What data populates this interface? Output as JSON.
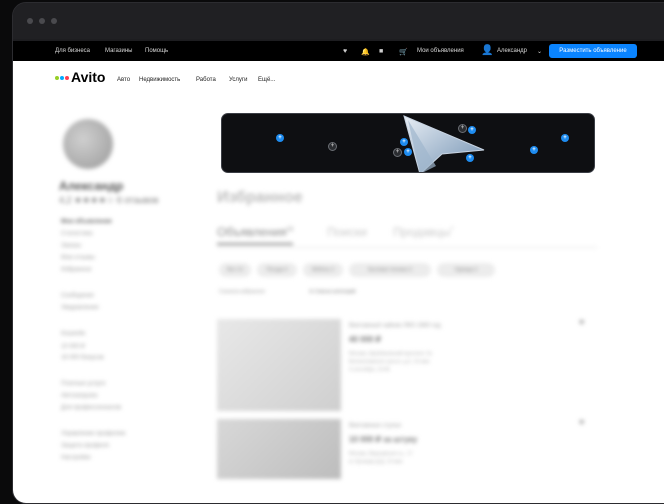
{
  "topbar": {
    "business": "Для бизнеса",
    "shops": "Магазины",
    "help": "Помощь",
    "my_ads": "Мои объявления",
    "user": "Александр",
    "post_button": "Разместить объявление"
  },
  "header": {
    "logo": "Avito",
    "nav": [
      "Авто",
      "Недвижимость",
      "Работа",
      "Услуги",
      "Ещё..."
    ]
  },
  "profile": {
    "name": "Александр",
    "rating": "4,2 ★★★★☆ 6 отзывов",
    "menu": [
      "Мои объявления",
      "Статистика",
      "Заказы",
      "Мои отзывы",
      "Избранное",
      "Сообщения",
      "Уведомления",
      "Кошелёк",
      "10 000 ₽",
      "16 000 бонусов",
      "Платные услуги",
      "Автозагрузка",
      "Для профессионалов",
      "Управление профилем",
      "Защита профиля",
      "Настройки"
    ]
  },
  "main": {
    "title": "Избранное",
    "tabs": [
      {
        "label": "Объявления",
        "count": "13"
      },
      {
        "label": "Поиски",
        "count": ""
      },
      {
        "label": "Продавцы",
        "count": "7"
      }
    ],
    "chips": [
      "Все 13",
      "Посуда 4",
      "Мебель 3",
      "Бытовая техника 3",
      "Одежда 3"
    ],
    "sort_left": "Сначала избранное",
    "sort_right": "⇅ Список категорий",
    "cards": [
      {
        "title": "Винтажный чайник ЛФЗ 1960 год",
        "price": "40 000 ₽",
        "sub1": "Москва, Щербаковский проспект, 5к",
        "sub2": "Волоколамское шоссе, д.2, 15 мин",
        "sub3": "4 сентября, 19:45"
      },
      {
        "title": "Винтажные стулья",
        "price": "10 000 ₽ за штуку",
        "sub1": "Москва, Варшавское ш., 17",
        "sub2": "м. Бульвар Д.Д, 15 мин",
        "sub3": ""
      }
    ]
  },
  "overlay": {
    "nodes": [
      "+",
      "+",
      "+",
      "+",
      "+",
      "+",
      "+",
      "+",
      "+",
      "+"
    ]
  }
}
